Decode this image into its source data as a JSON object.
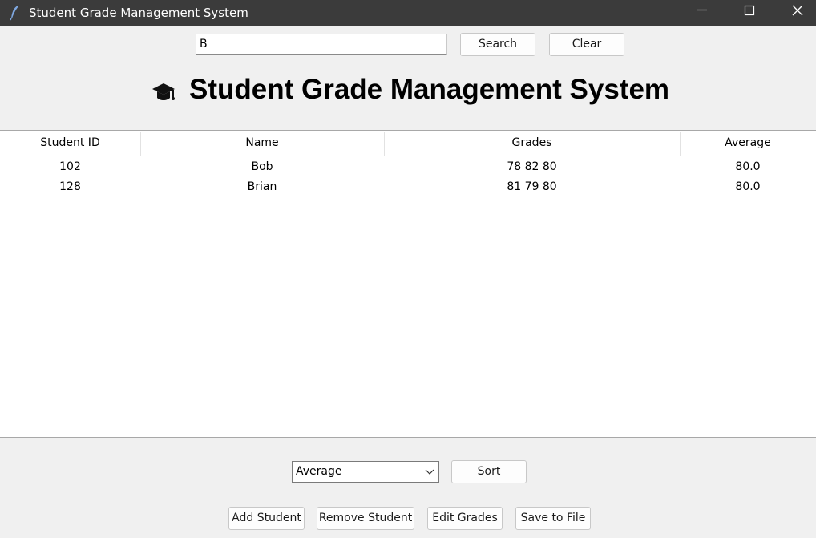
{
  "window": {
    "title": "Student Grade Management System"
  },
  "search": {
    "value": "B",
    "search_label": "Search",
    "clear_label": "Clear"
  },
  "header": {
    "title": "Student Grade Management System",
    "icon": "graduation-cap-icon"
  },
  "table": {
    "columns": [
      "Student ID",
      "Name",
      "Grades",
      "Average"
    ],
    "rows": [
      {
        "id": "102",
        "name": "Bob",
        "grades": "78 82 80",
        "average": "80.0"
      },
      {
        "id": "128",
        "name": "Brian",
        "grades": "81 79 80",
        "average": "80.0"
      }
    ]
  },
  "sort": {
    "selected": "Average",
    "button_label": "Sort"
  },
  "actions": {
    "add": "Add Student",
    "remove": "Remove Student",
    "edit": "Edit Grades",
    "save": "Save to File"
  }
}
